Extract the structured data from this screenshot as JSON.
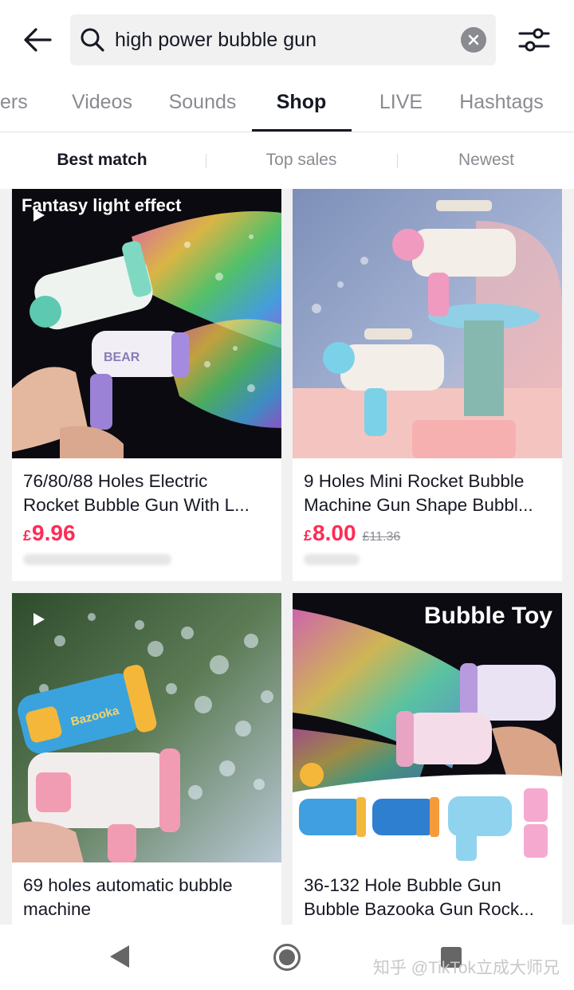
{
  "search": {
    "query": "high power bubble gun"
  },
  "tabs": [
    {
      "label": "ers"
    },
    {
      "label": "Videos"
    },
    {
      "label": "Sounds"
    },
    {
      "label": "Shop"
    },
    {
      "label": "LIVE"
    },
    {
      "label": "Hashtags"
    }
  ],
  "sort": [
    {
      "label": "Best match"
    },
    {
      "label": "Top sales"
    },
    {
      "label": "Newest"
    }
  ],
  "products": [
    {
      "title_line1": "76/80/88 Holes Electric",
      "title_line2": "Rocket Bubble Gun With L...",
      "currency": "£",
      "price": "9.96",
      "old_price": "",
      "image_text": "Fantasy light effect",
      "image_word": "BEAR"
    },
    {
      "title_line1": "9 Holes Mini Rocket Bubble",
      "title_line2": "Machine Gun Shape Bubbl...",
      "currency": "£",
      "price": "8.00",
      "old_price": "£11.36"
    },
    {
      "title_line1": "69 holes automatic bubble",
      "title_line2": "machine",
      "image_word": "Bazooka"
    },
    {
      "title_line1": "36-132 Hole Bubble Gun",
      "title_line2": "Bubble Bazooka Gun Rock...",
      "image_text": "Bubble Toy"
    }
  ],
  "watermark": "知乎 @TikTok立成大师兄",
  "colors": {
    "accent_price": "#fe2c55",
    "active_tab": "#161823",
    "inactive": "#8a8b91"
  },
  "icons": {
    "back": "back-arrow-icon",
    "search": "search-icon",
    "clear": "clear-icon",
    "filter": "filter-sliders-icon",
    "play": "play-icon"
  }
}
